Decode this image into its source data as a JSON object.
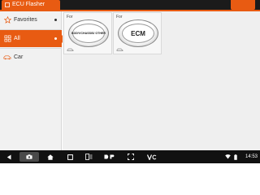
{
  "app": {
    "title": "ECU Flasher"
  },
  "sidebar": {
    "items": [
      {
        "label": "Favorites",
        "icon": "star-icon"
      },
      {
        "label": "All",
        "icon": "grid-icon",
        "active": true
      },
      {
        "label": "Car",
        "icon": "car-icon"
      }
    ]
  },
  "cards": [
    {
      "for_label": "For",
      "button_label": "BODY/CHASSIS/ OTHER"
    },
    {
      "for_label": "For",
      "button_label": "ECM"
    }
  ],
  "statusbar": {
    "time": "14:53"
  },
  "colors": {
    "accent": "#e85b12",
    "topbar": "#1b1b1b",
    "bottombar": "#111111"
  }
}
